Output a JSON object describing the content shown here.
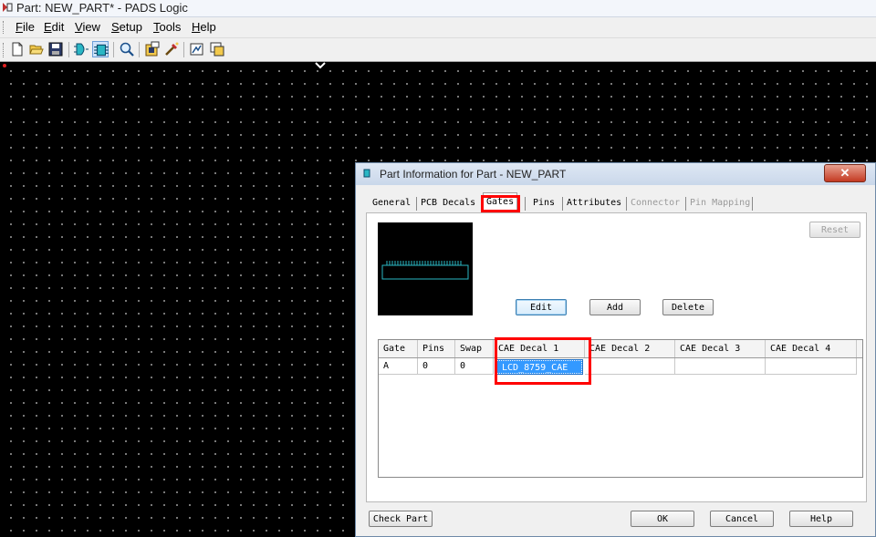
{
  "window": {
    "title": "Part: NEW_PART* - PADS Logic"
  },
  "menu": {
    "items": [
      {
        "label": "File",
        "accel": "F",
        "rest": "ile"
      },
      {
        "label": "Edit",
        "accel": "E",
        "rest": "dit"
      },
      {
        "label": "View",
        "accel": "V",
        "rest": "iew"
      },
      {
        "label": "Setup",
        "accel": "S",
        "rest": "etup"
      },
      {
        "label": "Tools",
        "accel": "T",
        "rest": "ools"
      },
      {
        "label": "Help",
        "accel": "H",
        "rest": "elp"
      }
    ]
  },
  "toolbar": {
    "icons": [
      "new-icon",
      "open-icon",
      "save-icon",
      "gate-icon",
      "part-icon",
      "zoom-icon",
      "library-icon",
      "decal-wizard-icon",
      "report-icon",
      "window-icon"
    ]
  },
  "dialog": {
    "title": "Part Information for Part - NEW_PART",
    "close_label": "✕",
    "tabs": [
      {
        "label": "General"
      },
      {
        "label": "PCB Decals"
      },
      {
        "label": "Gates"
      },
      {
        "label": "Pins"
      },
      {
        "label": "Attributes"
      },
      {
        "label": "Connector"
      },
      {
        "label": "Pin Mapping"
      }
    ],
    "active_tab": "Gates",
    "buttons": {
      "reset": "Reset",
      "edit": "Edit",
      "add": "Add",
      "delete": "Delete",
      "check_part": "Check Part",
      "ok": "OK",
      "cancel": "Cancel",
      "help": "Help"
    },
    "table": {
      "columns": [
        "Gate",
        "Pins",
        "Swap",
        "CAE Decal 1",
        "CAE Decal 2",
        "CAE Decal 3",
        "CAE Decal 4"
      ],
      "rows": [
        [
          "A",
          "0",
          "0",
          "LCD_8759_CAE",
          "",
          "",
          ""
        ]
      ]
    }
  },
  "colors": {
    "highlight": "#ff0000",
    "selection": "#3399ff",
    "preview_outline": "#2ab7c4"
  }
}
